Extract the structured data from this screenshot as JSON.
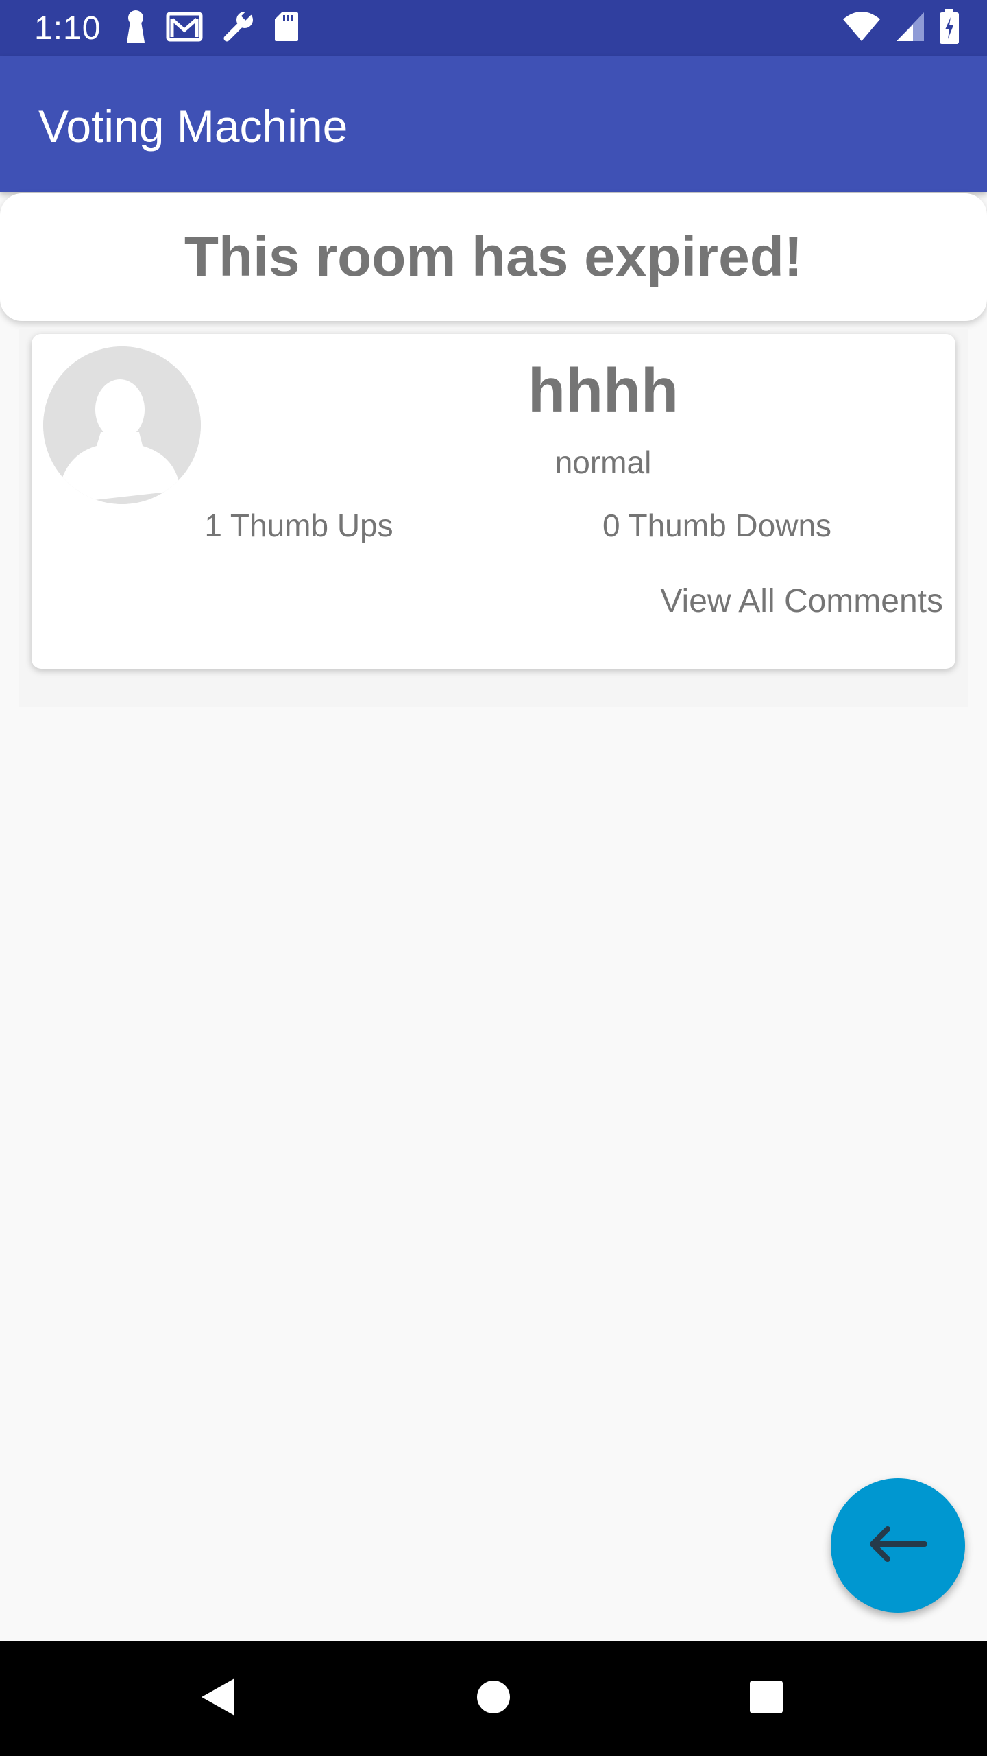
{
  "status_bar": {
    "time": "1:10",
    "left_icons": [
      "keyhole-icon",
      "gmail-icon",
      "wrench-icon",
      "sd-card-icon"
    ],
    "right_icons": [
      "wifi-icon",
      "signal-icon",
      "battery-charging-icon"
    ]
  },
  "app_bar": {
    "title": "Voting Machine"
  },
  "banner": {
    "text": "This room has expired!"
  },
  "candidates": [
    {
      "name": "hhhh",
      "type": "normal",
      "thumb_ups": "1 Thumb Ups",
      "thumb_downs": "0 Thumb Downs",
      "comments_link": "View All Comments",
      "avatar_icon": "default-avatar-icon"
    }
  ],
  "fab": {
    "icon": "arrow-left-icon"
  },
  "nav_bar": {
    "icons": [
      "back-triangle-icon",
      "home-circle-icon",
      "recents-square-icon"
    ]
  },
  "colors": {
    "status_bar": "#303f9f",
    "app_bar": "#3f51b5",
    "fab": "#0097d0",
    "text_gray": "#757575",
    "background": "#f9f9f9"
  }
}
